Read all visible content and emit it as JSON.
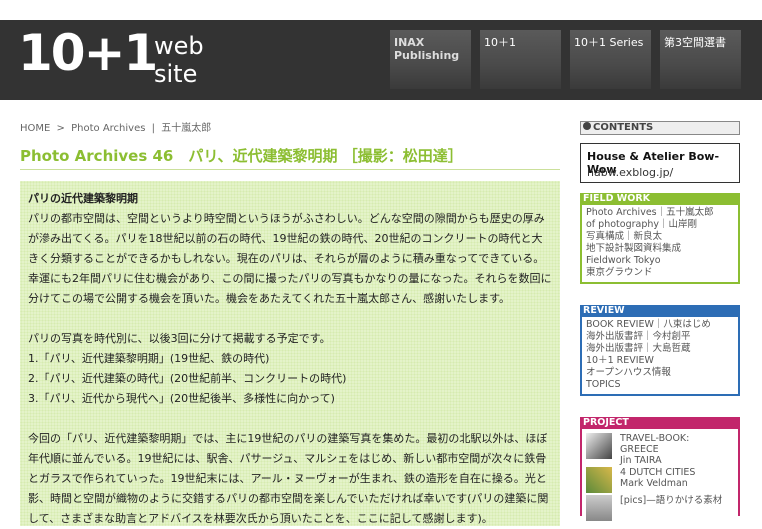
{
  "header": {
    "logo_num": "10+1",
    "logo_suffix": "web site",
    "tabs": [
      {
        "line1": "INAX",
        "line2": "Publishing"
      },
      {
        "line1": "10＋1",
        "line2": ""
      },
      {
        "line1": "10＋1 Series",
        "line2": ""
      },
      {
        "line1": "第3空間選書",
        "line2": ""
      }
    ]
  },
  "breadcrumb": {
    "home": "HOME",
    "sep": ">",
    "section": "Photo Archives",
    "pipe": "|",
    "author": "五十嵐太郎"
  },
  "title": "Photo Archives 46　パリ、近代建築黎明期 ［撮影：松田達］",
  "article": {
    "heading": "パリの近代建築黎明期",
    "p1": "パリの都市空間は、空間というより時空間というほうがふさわしい。どんな空間の隙間からも歴史の厚みが滲み出てくる。パリを18世紀以前の石の時代、19世紀の鉄の時代、20世紀のコンクリートの時代と大きく分類することができるかもしれない。現在のパリは、それらが層のように積み重なってできている。幸運にも2年間パリに住む機会があり、この間に撮ったパリの写真もかなりの量になった。それらを数回に分けてこの場で公開する機会を頂いた。機会をあたえてくれた五十嵐太郎さん、感謝いたします。",
    "p2": "パリの写真を時代別に、以後3回に分けて掲載する予定です。",
    "list": [
      "1.「パリ、近代建築黎明期」(19世紀、鉄の時代)",
      "2.「パリ、近代建築の時代」(20世紀前半、コンクリートの時代)",
      "3.「パリ、近代から現代へ」(20世紀後半、多様性に向かって)"
    ],
    "p3": "今回の「パリ、近代建築黎明期」では、主に19世紀のパリの建築写真を集めた。最初の北駅以外は、ほぼ年代順に並んでいる。19世紀には、駅舎、パサージュ、マルシェをはじめ、新しい都市空間が次々に鉄骨とガラスで作られていった。19世紀末には、アール・ヌーヴォーが生まれ、鉄の造形を自在に操る。光と影、時間と空間が織物のように交錯するパリの都市空間を楽しんでいただければ幸いです(パリの建築に関して、さまざまな助言とアドバイスを林要次氏から頂いたことを、ここに記して感謝します)。"
  },
  "sidebar": {
    "contents_label": "CONTENTS",
    "promo_title": "House & Atelier Bow-Wow",
    "promo_url": "habw.exblog.jp/",
    "field_work": {
      "label": "FIELD WORK",
      "items": [
        "Photo Archives｜五十嵐太郎",
        "of photography｜山岸剛",
        "写真構成｜新良太",
        "地下設計製図資料集成",
        "Fieldwork Tokyo",
        "東京グラウンド"
      ]
    },
    "review": {
      "label": "REVIEW",
      "items": [
        "BOOK REVIEW｜八束はじめ",
        "海外出版書評｜今村創平",
        "海外出版書評｜大島哲蔵",
        "10＋1 REVIEW",
        "オープンハウス情報",
        "TOPICS"
      ]
    },
    "project": {
      "label": "PROJECT",
      "items": [
        {
          "l1": "TRAVEL-BOOK:",
          "l2": "GREECE",
          "l3": "Jin TAIRA"
        },
        {
          "l1": "4 DUTCH CITIES",
          "l2": "Mark Veldman",
          "l3": ""
        },
        {
          "l1": "[pics]—語りかける素材",
          "l2": "",
          "l3": ""
        }
      ]
    }
  }
}
